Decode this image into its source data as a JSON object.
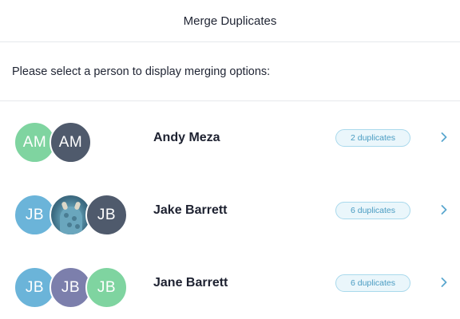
{
  "header": {
    "title": "Merge Duplicates"
  },
  "prompt": {
    "text": "Please select a person to display merging options:"
  },
  "people": [
    {
      "name": "Andy Meza",
      "badge": "2 duplicates",
      "avatars": [
        {
          "initials": "AM",
          "color": "#7fd4a0"
        },
        {
          "initials": "AM",
          "color": "#4f5a6c"
        }
      ]
    },
    {
      "name": "Jake Barrett",
      "badge": "6 duplicates",
      "avatars": [
        {
          "initials": "JB",
          "color": "#6bb4d9"
        },
        {
          "initials": "",
          "color": "#5a93a9",
          "photo": "monster-photo"
        },
        {
          "initials": "JB",
          "color": "#4f5a6c"
        }
      ]
    },
    {
      "name": "Jane Barrett",
      "badge": "6 duplicates",
      "avatars": [
        {
          "initials": "JB",
          "color": "#6bb4d9"
        },
        {
          "initials": "JB",
          "color": "#7c7fac"
        },
        {
          "initials": "JB",
          "color": "#7fd4a0"
        }
      ]
    }
  ],
  "colors": {
    "badge_text": "#4a9cc2",
    "badge_border": "#a9d9ec",
    "chevron": "#5aa7cf",
    "divider": "#e6e8ec"
  },
  "icons": {
    "row_chevron": "chevron-right-icon"
  }
}
